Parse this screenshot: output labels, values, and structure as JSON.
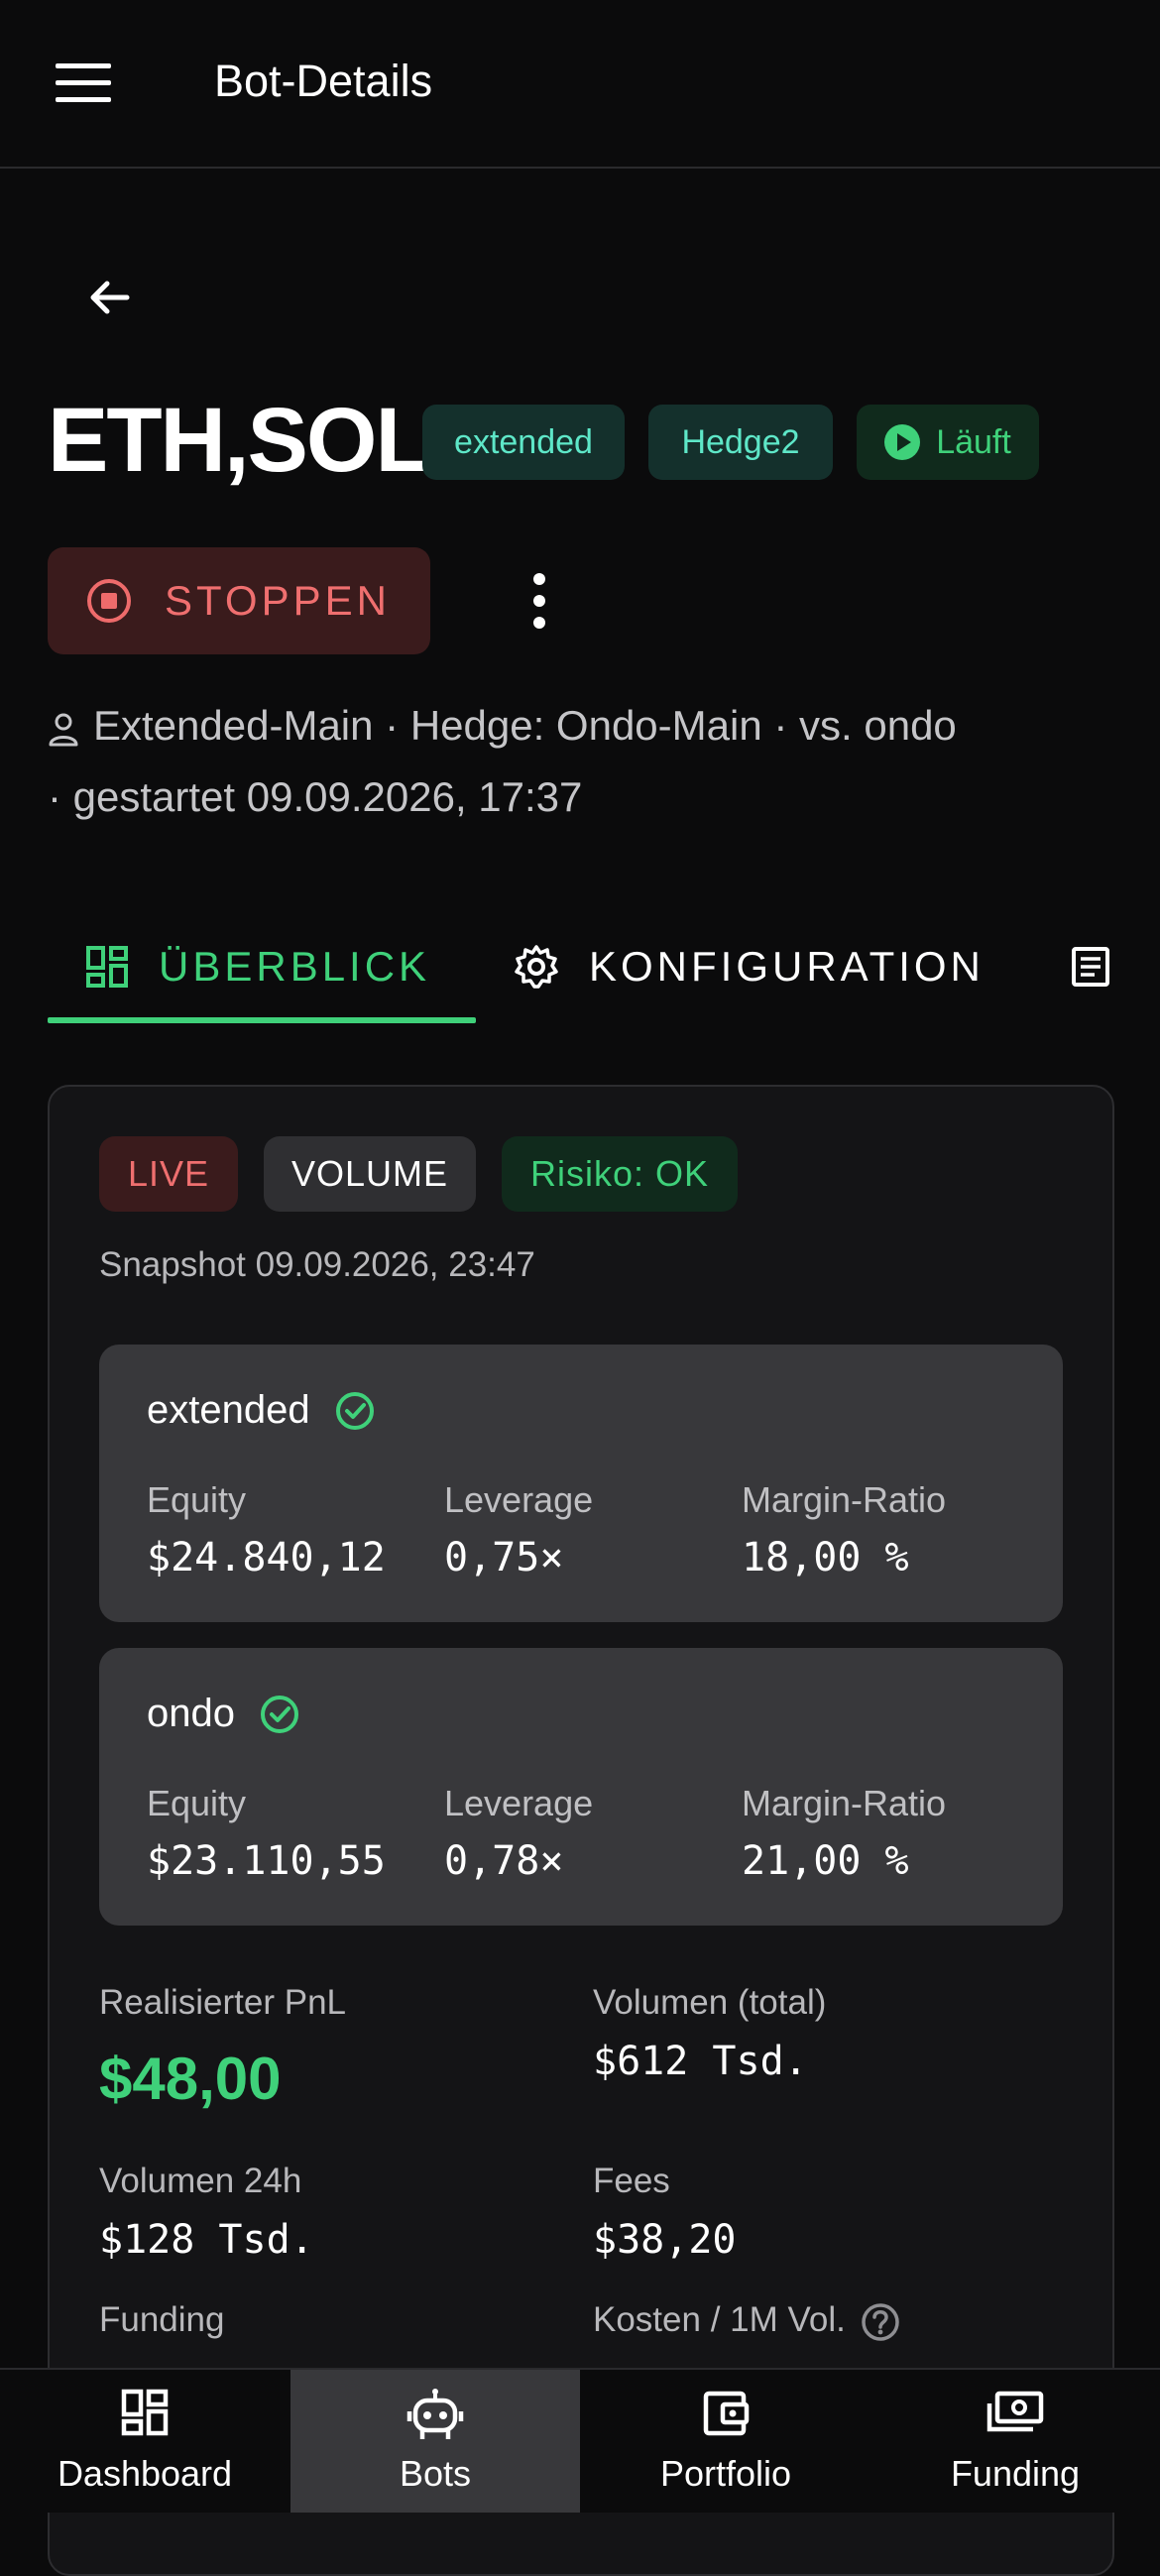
{
  "appbar": {
    "title": "Bot-Details"
  },
  "bot": {
    "title": "ETH,SOL",
    "chips": {
      "venue": "extended",
      "strategy": "Hedge2",
      "status": "Läuft"
    },
    "stop_label": "STOPPEN",
    "meta_line1": "Extended-Main · Hedge: Ondo-Main · vs. ondo",
    "meta_line2": "· gestartet 09.09.2026, 17:37"
  },
  "tabs": [
    {
      "label": "ÜBERBLICK",
      "icon": "dashboard-icon",
      "active": true
    },
    {
      "label": "KONFIGURATION",
      "icon": "gear-icon"
    },
    {
      "label": "",
      "icon": "log-icon"
    }
  ],
  "overview": {
    "badges": {
      "live": "LIVE",
      "volume": "VOLUME",
      "risk": "Risiko: OK"
    },
    "snapshot": "Snapshot 09.09.2026, 23:47",
    "venues": [
      {
        "name": "extended",
        "equity_label": "Equity",
        "equity": "$24.840,12",
        "leverage_label": "Leverage",
        "leverage": "0,75×",
        "margin_label": "Margin-Ratio",
        "margin": "18,00 %"
      },
      {
        "name": "ondo",
        "equity_label": "Equity",
        "equity": "$23.110,55",
        "leverage_label": "Leverage",
        "leverage": "0,78×",
        "margin_label": "Margin-Ratio",
        "margin": "21,00 %"
      }
    ],
    "stats": {
      "pnl_label": "Realisierter PnL",
      "pnl": "$48,00",
      "volume_total_label": "Volumen (total)",
      "volume_total": "$612 Tsd.",
      "volume_24h_label": "Volumen 24h",
      "volume_24h": "$128 Tsd.",
      "fees_label": "Fees",
      "fees": "$38,20",
      "funding_label": "Funding",
      "cost_label": "Kosten / 1M Vol."
    }
  },
  "colors": {
    "accent": "#3fd17a",
    "danger": "#ef6f6f",
    "teal": "#5ee7c8",
    "background": "#0b0b0c"
  },
  "bottom_nav": [
    {
      "label": "Dashboard",
      "icon": "dashboard-icon"
    },
    {
      "label": "Bots",
      "icon": "robot-icon",
      "active": true
    },
    {
      "label": "Portfolio",
      "icon": "wallet-icon"
    },
    {
      "label": "Funding",
      "icon": "cash-icon"
    }
  ]
}
